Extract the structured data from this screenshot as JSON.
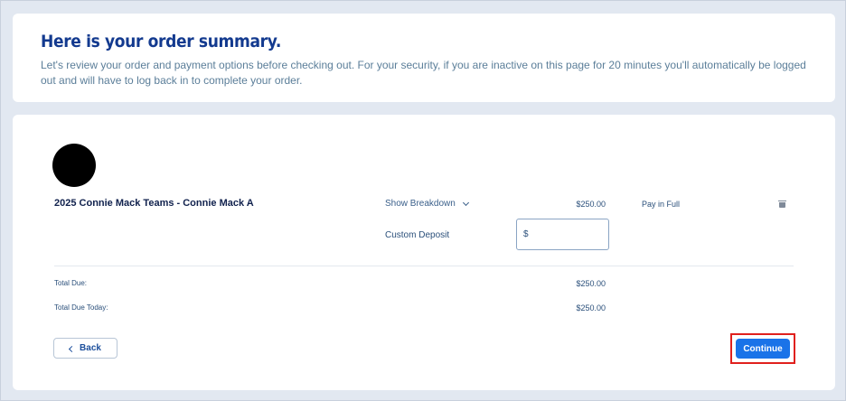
{
  "header": {
    "title": "Here is your order summary.",
    "intro": "Let's review your order and payment options before checking out. For your security, if you are inactive on this page for 20 minutes you'll automatically be logged out and will have to log back in to complete your order."
  },
  "order": {
    "item_name": "2025 Connie Mack Teams - Connie Mack A",
    "show_breakdown_label": "Show Breakdown",
    "amount": "$250.00",
    "payment_option": "Pay in Full",
    "custom_deposit_label": "Custom Deposit",
    "deposit_currency": "$",
    "deposit_value": ""
  },
  "totals": {
    "total_due_label": "Total Due:",
    "total_due_value": "$250.00",
    "total_due_today_label": "Total Due Today:",
    "total_due_today_value": "$250.00"
  },
  "actions": {
    "back_label": "Back",
    "continue_label": "Continue"
  },
  "colors": {
    "accent": "#1a73e8",
    "title": "#133a8f",
    "highlight": "#e0201d"
  },
  "icons": [
    "chevron-down-icon",
    "trash-icon",
    "chevron-left-icon"
  ]
}
